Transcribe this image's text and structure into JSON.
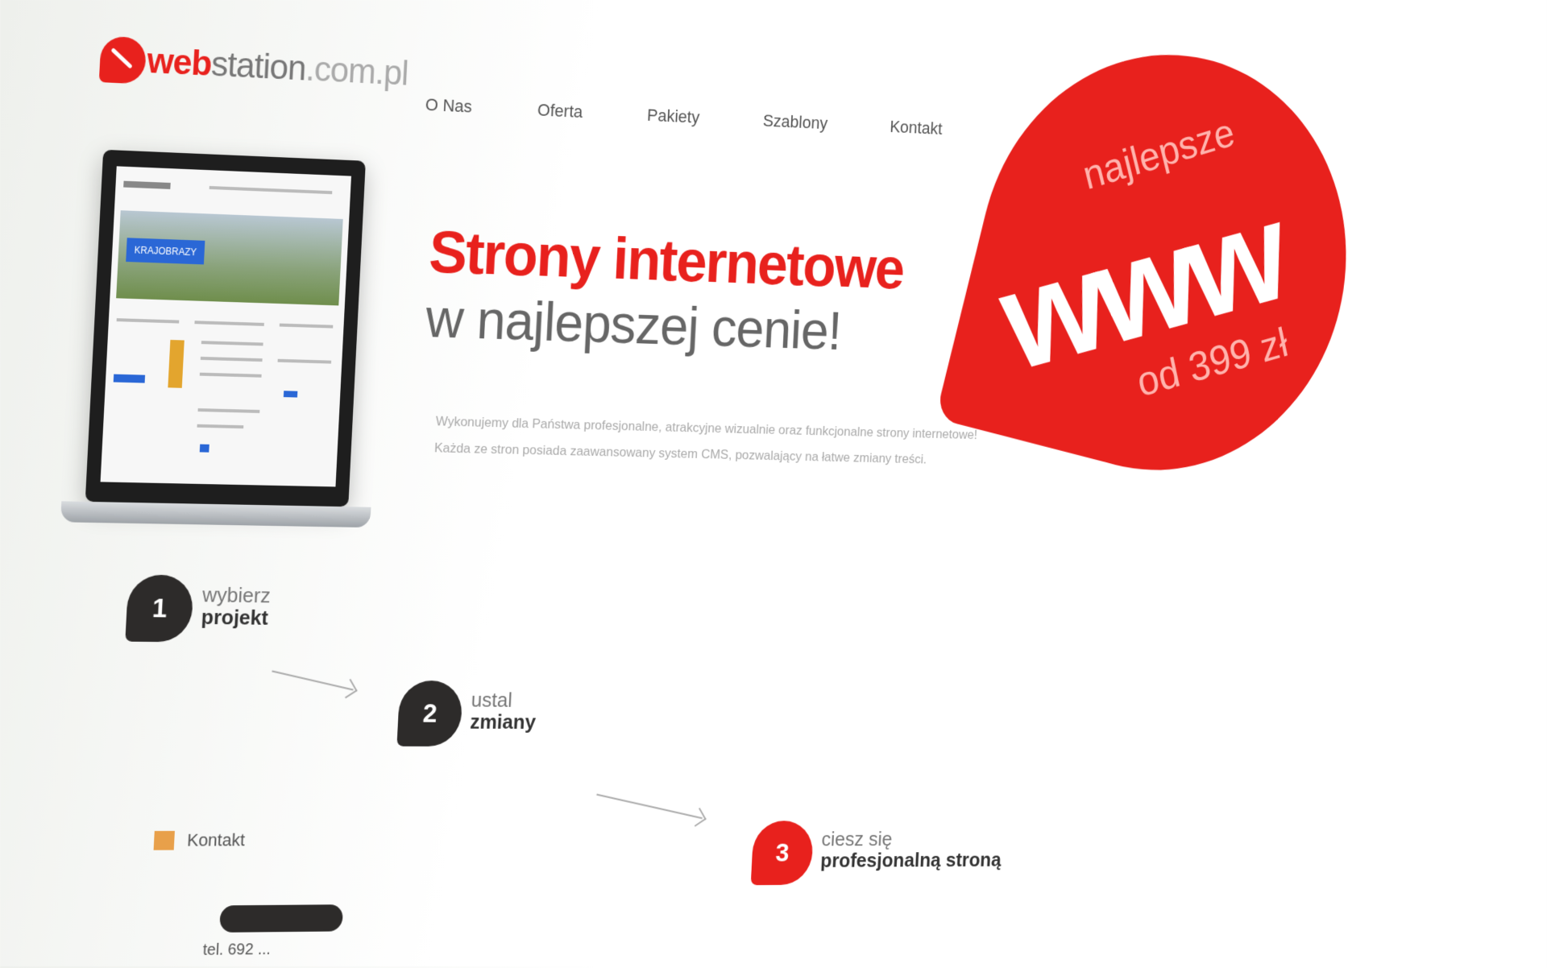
{
  "header": {
    "logo": {
      "web": "web",
      "station": "station",
      "tld": ".com.pl"
    },
    "nav": [
      "O Nas",
      "Oferta",
      "Pakiety",
      "Szablony",
      "Kontakt"
    ]
  },
  "laptop_preview": {
    "banner_label": "KRAJOBRAZY"
  },
  "hero": {
    "line1": "Strony internetowe",
    "line2": "w najlepszej cenie!",
    "desc1": "Wykonujemy dla Państwa profesjonalne, atrakcyjne wizualnie oraz funkcjonalne strony internetowe!",
    "desc2": "Każda ze stron posiada zaawansowany system CMS, pozwalający na łatwe zmiany treści."
  },
  "badge": {
    "top": "najlepsze",
    "main": "www",
    "price": "od 399 zł"
  },
  "steps": [
    {
      "num": "1",
      "line1": "wybierz",
      "line2": "projekt"
    },
    {
      "num": "2",
      "line1": "ustal",
      "line2": "zmiany"
    },
    {
      "num": "3",
      "line1": "ciesz się",
      "line2": "profesjonalną stroną"
    }
  ],
  "contact": {
    "title": "Kontakt",
    "phone": "tel. 692 ..."
  },
  "colors": {
    "accent": "#e8211d",
    "dark": "#2d2b2a"
  }
}
